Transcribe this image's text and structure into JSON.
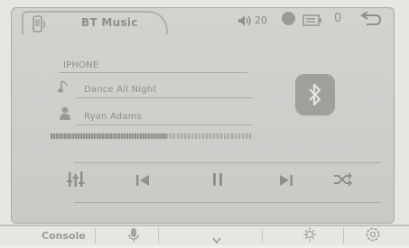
{
  "header": {
    "title": "BT Music",
    "volume_level": "20",
    "indicator_number": "0",
    "icons": [
      "phone-icon",
      "volume-icon",
      "signal-icon",
      "battery-icon",
      "back-icon"
    ]
  },
  "player": {
    "device_label": "IPHONE",
    "track_title": "Dance All Night",
    "artist": "Ryan Adams",
    "progress": 0.57,
    "icons": [
      "music-note-icon",
      "person-icon",
      "bluetooth-icon"
    ]
  },
  "controls": {
    "icons": [
      "equalizer-icon",
      "previous-track-icon",
      "pause-icon",
      "next-track-icon",
      "shuffle-icon"
    ]
  },
  "footer": {
    "console_label": "Console",
    "icons": [
      "microphone-icon",
      "chevron-down-icon",
      "brightness-icon",
      "settings-icon"
    ]
  },
  "colors": {
    "panel_background": "#cfcfcc",
    "text": "#8f8f8c",
    "icon": "#9a9a97",
    "divider": "#aaaaa7"
  }
}
